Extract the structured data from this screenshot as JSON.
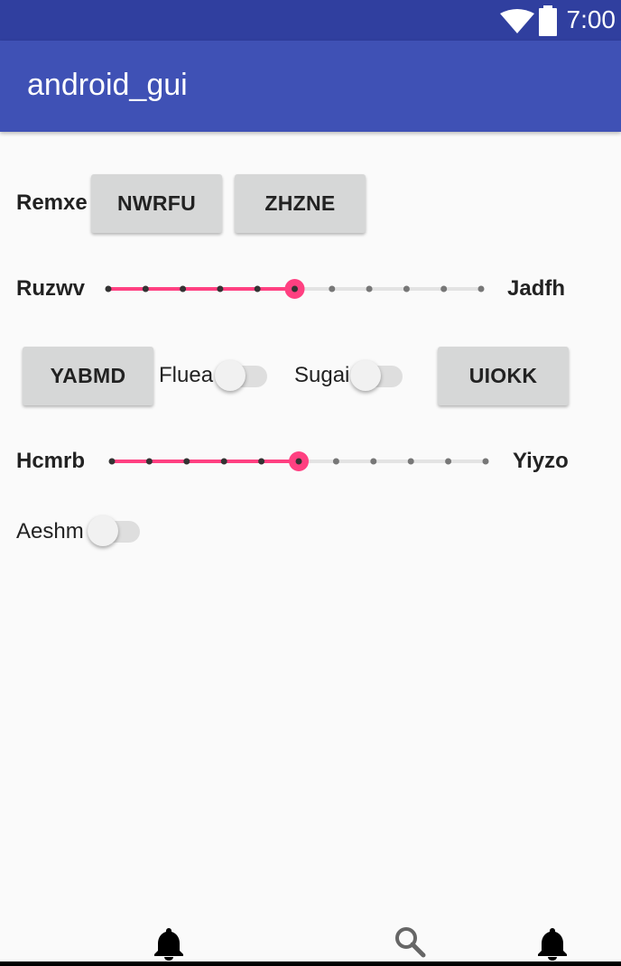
{
  "status_bar": {
    "time": "7:00",
    "icons": [
      "wifi-icon",
      "battery-icon"
    ],
    "color": "#303f9f"
  },
  "app_bar": {
    "title": "android_gui",
    "color": "#3f51b5"
  },
  "row1": {
    "label": "Remxe",
    "button1": "NWRFU",
    "button2": "ZHZNE"
  },
  "slider1": {
    "min_label": "Ruzwv",
    "max_label": "Jadfh",
    "value": 5,
    "max": 10
  },
  "row3": {
    "button1": "YABMD",
    "switch1_label": "Fluea",
    "switch1_on": false,
    "switch2_label": "Sugai",
    "switch2_on": false,
    "button2": "UIOKK"
  },
  "slider2": {
    "min_label": "Hcmrb",
    "max_label": "Yiyzo",
    "value": 5,
    "max": 10
  },
  "row5": {
    "switch_label": "Aeshm",
    "switch_on": false
  },
  "accent_color": "#ff4081",
  "bottom_nav": {
    "icons": [
      "bell-icon",
      "search-icon",
      "bell-icon"
    ]
  }
}
